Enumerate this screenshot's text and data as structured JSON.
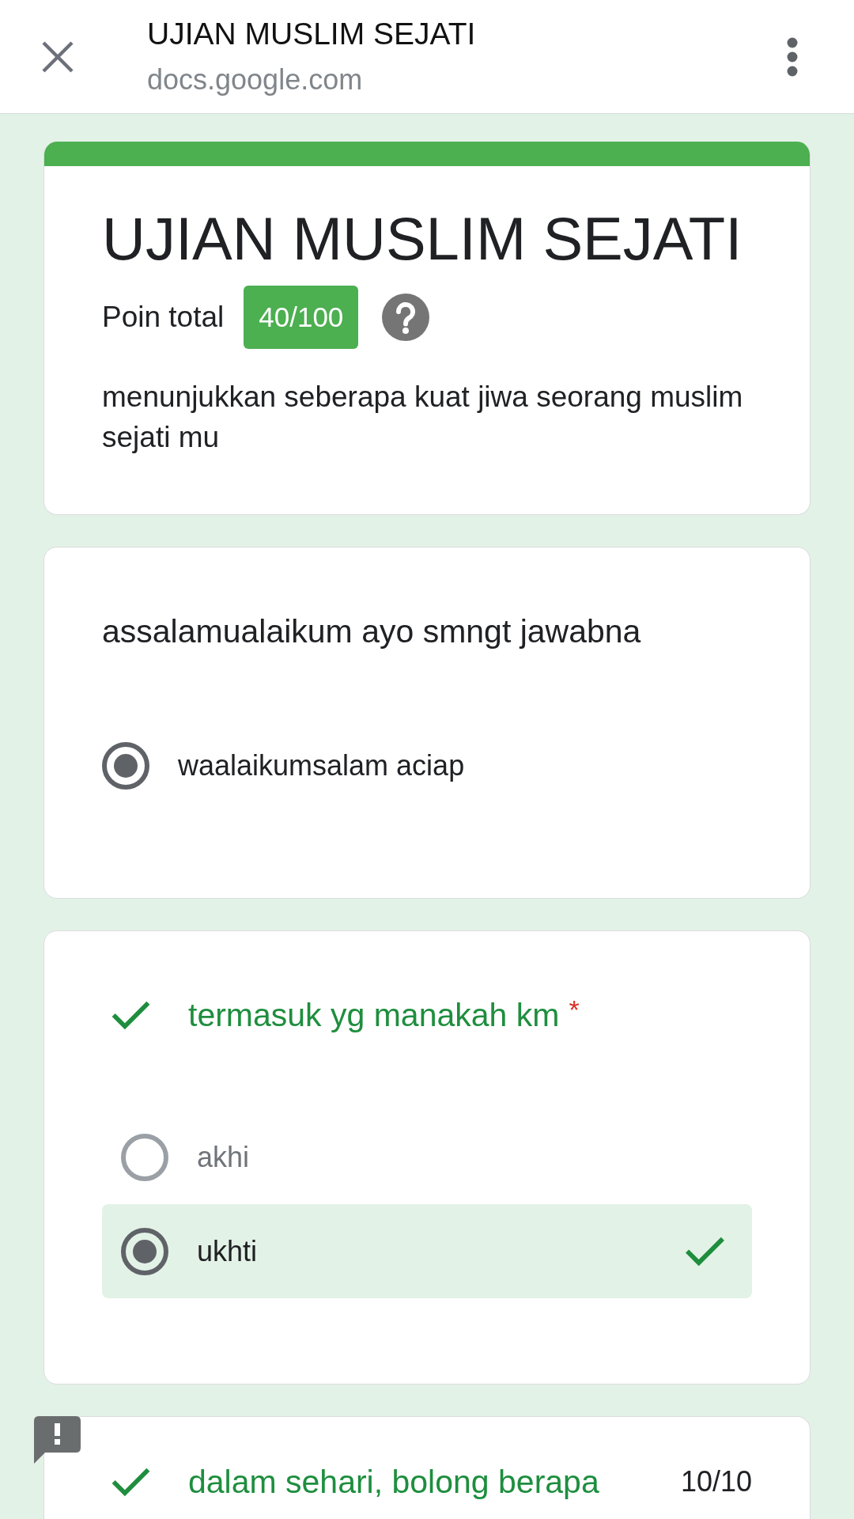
{
  "browser_bar": {
    "title": "UJIAN MUSLIM SEJATI",
    "domain": "docs.google.com"
  },
  "form_header": {
    "title": "UJIAN MUSLIM SEJATI",
    "score_label": "Poin total",
    "score": "40/100",
    "description": "menunjukkan seberapa kuat jiwa seorang muslim sejati mu"
  },
  "questions": [
    {
      "text": "assalamualaikum ayo smngt jawabna",
      "graded": false,
      "flagged": false,
      "options": [
        {
          "label": "waalaikumsalam aciap",
          "selected": true,
          "correct": false
        }
      ]
    },
    {
      "text": "termasuk yg manakah km",
      "required_mark": "*",
      "graded": true,
      "correct": true,
      "flagged": false,
      "options": [
        {
          "label": "akhi",
          "selected": false,
          "correct": false
        },
        {
          "label": "ukhti",
          "selected": true,
          "correct": true
        }
      ]
    },
    {
      "text": "dalam sehari, bolong berapa",
      "graded": true,
      "correct": true,
      "flagged": true,
      "points": "10/10"
    }
  ]
}
